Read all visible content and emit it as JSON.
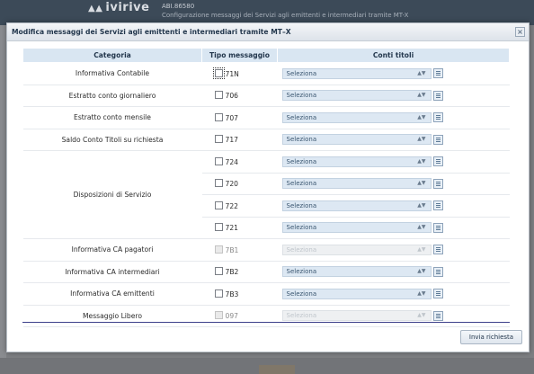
{
  "background": {
    "logo": "ivirive",
    "abi": "ABI.86580",
    "subtitle": "Configurazione messaggi dei Servizi agli emittenti e intermediari tramite MT-X"
  },
  "dialog": {
    "title": "Modifica messaggi dei Servizi agli emittenti e intermediari tramite MT–X",
    "close_symbol": "×",
    "headers": {
      "categoria": "Categoria",
      "tipo": "Tipo messaggio",
      "conti": "Conti titoli"
    },
    "rows": [
      {
        "categoria": "Informativa Contabile",
        "code": "71N",
        "select": "Seleziona",
        "enabled": true
      },
      {
        "categoria": "Estratto conto giornaliero",
        "code": "706",
        "select": "Seleziona",
        "enabled": true
      },
      {
        "categoria": "Estratto conto mensile",
        "code": "707",
        "select": "Seleziona",
        "enabled": true
      },
      {
        "categoria": "Saldo Conto Titoli su richiesta",
        "code": "717",
        "select": "Seleziona",
        "enabled": true
      },
      {
        "categoria": "Disposizioni di Servizio",
        "code": "724",
        "select": "Seleziona",
        "enabled": true
      },
      {
        "categoria": "",
        "code": "720",
        "select": "Seleziona",
        "enabled": true
      },
      {
        "categoria": "",
        "code": "722",
        "select": "Seleziona",
        "enabled": true
      },
      {
        "categoria": "",
        "code": "721",
        "select": "Seleziona",
        "enabled": true
      },
      {
        "categoria": "Informativa CA pagatori",
        "code": "7B1",
        "select": "Seleziona",
        "enabled": false
      },
      {
        "categoria": "Informativa CA intermediari",
        "code": "7B2",
        "select": "Seleziona",
        "enabled": true
      },
      {
        "categoria": "Informativa CA emittenti",
        "code": "7B3",
        "select": "Seleziona",
        "enabled": true
      },
      {
        "categoria": "Messaggio Libero",
        "code": "097",
        "select": "Seleziona",
        "enabled": false
      }
    ],
    "send_button": "Invia richiesta"
  }
}
